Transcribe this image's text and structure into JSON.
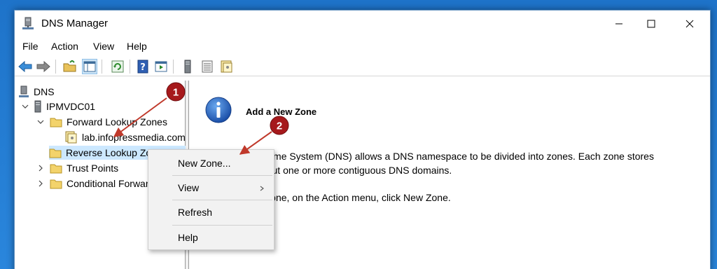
{
  "window": {
    "title": "DNS Manager"
  },
  "menu": [
    "File",
    "Action",
    "View",
    "Help"
  ],
  "tree": {
    "root": "DNS",
    "server": "IPMVDC01",
    "forward_zones": "Forward Lookup Zones",
    "zone_item": "lab.infopressmedia.com",
    "reverse_zones": "Reverse Lookup Zones",
    "trust_points": "Trust Points",
    "conditional_forwarders": "Conditional Forwarders"
  },
  "content": {
    "title": "Add a New Zone",
    "line1": "The Domain Name System (DNS) allows a DNS namespace to be divided into zones. Each zone stores",
    "line2": "information about one or more contiguous DNS domains.",
    "line3": "To add a new zone, on the Action menu, click New Zone."
  },
  "context_menu": {
    "new_zone": "New Zone...",
    "view": "View",
    "refresh": "Refresh",
    "help": "Help"
  },
  "annotations": {
    "marker1": "1",
    "marker2": "2"
  },
  "colors": {
    "accent": "#0078d7",
    "annotation": "#b01e1e",
    "selection": "#cce8ff"
  }
}
